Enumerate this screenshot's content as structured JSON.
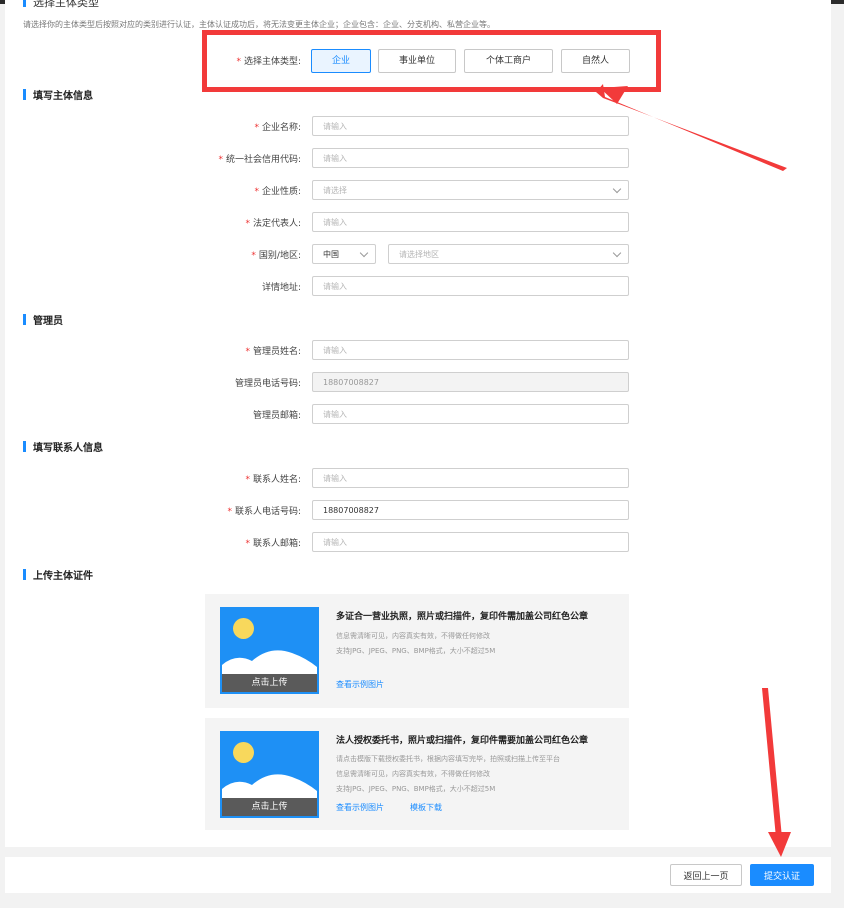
{
  "intro": {
    "title": "选择主体类型",
    "desc": "请选择你的主体类型后按照对应的类别进行认证，主体认证成功后，将无法变更主体企业；企业包含：企业、分支机构、私营企业等。"
  },
  "entity_type": {
    "label": "选择主体类型:",
    "options": [
      "企业",
      "事业单位",
      "个体工商户",
      "自然人"
    ],
    "selected": "企业"
  },
  "sections": {
    "subject": "填写主体信息",
    "admin": "管理员",
    "contact": "填写联系人信息",
    "upload": "上传主体证件"
  },
  "subject_fields": {
    "company_name": {
      "label": "企业名称:",
      "placeholder": "请输入"
    },
    "credit_code": {
      "label": "统一社会信用代码:",
      "placeholder": "请输入"
    },
    "company_nature": {
      "label": "企业性质:",
      "placeholder": "请选择"
    },
    "legal_rep": {
      "label": "法定代表人:",
      "placeholder": "请输入"
    },
    "country": {
      "label": "国别/地区:",
      "country_value": "中国",
      "region_placeholder": "请选择地区"
    },
    "address": {
      "label": "详情地址:",
      "placeholder": "请输入"
    }
  },
  "admin_fields": {
    "name": {
      "label": "管理员姓名:",
      "placeholder": "请输入"
    },
    "phone": {
      "label": "管理员电话号码:",
      "value": "18807008827"
    },
    "email": {
      "label": "管理员邮箱:",
      "placeholder": "请输入"
    }
  },
  "contact_fields": {
    "name": {
      "label": "联系人姓名:",
      "placeholder": "请输入"
    },
    "phone": {
      "label": "联系人电话号码:",
      "value": "18807008827"
    },
    "email": {
      "label": "联系人邮箱:",
      "placeholder": "请输入"
    }
  },
  "uploads": [
    {
      "title": "多证合一营业执照，照片或扫描件，复印件需加盖公司红色公章",
      "desc": [
        "信息需清晰可见，内容真实有效，不得做任何修改",
        "支持JPG、JPEG、PNG、BMP格式，大小不超过5M"
      ],
      "thumb_label": "点击上传",
      "link_sample": "查看示例图片"
    },
    {
      "title": "法人授权委托书，照片或扫描件，复印件需要加盖公司红色公章",
      "desc": [
        "请点击模版下载授权委托书，根据内容填写完毕，拍照或扫描上传至平台",
        "信息需清晰可见，内容真实有效，不得做任何修改",
        "支持JPG、JPEG、PNG、BMP格式，大小不超过5M"
      ],
      "thumb_label": "点击上传",
      "link_sample": "查看示例图片",
      "link_template": "模板下载"
    }
  ],
  "footer": {
    "back_label": "返回上一页",
    "submit_label": "提交认证"
  },
  "colors": {
    "accent": "#1a8cff",
    "annotation": "#f23a3a",
    "required": "#e33333"
  }
}
